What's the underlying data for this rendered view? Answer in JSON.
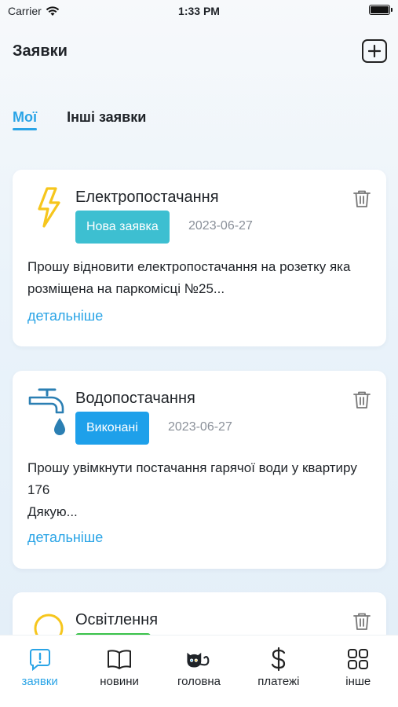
{
  "status_bar": {
    "carrier": "Carrier",
    "time": "1:33 PM"
  },
  "header": {
    "title": "Заявки",
    "add_icon": "plus-square-icon"
  },
  "tabs": [
    {
      "label": "Мої",
      "active": true
    },
    {
      "label": "Інші заявки",
      "active": false
    }
  ],
  "requests": [
    {
      "category": "Електропостачання",
      "icon": "lightning-icon",
      "status": "Нова заявка",
      "status_color": "#3dbfd1",
      "date": "2023-06-27",
      "description": "Прошу відновити електропостачання на розетку яка розміщена на паркомісці №25...",
      "more_label": "детальніше"
    },
    {
      "category": "Водопостачання",
      "icon": "water-tap-icon",
      "status": "Виконані",
      "status_color": "#1ea0ea",
      "date": "2023-06-27",
      "description": "Прошу увімкнути постачання гарячої води у квартиру 176\nДякую...",
      "more_label": "детальніше"
    },
    {
      "category": "Освітлення",
      "icon": "lightbulb-icon",
      "status_color": "#3ac24a"
    }
  ],
  "tabbar": [
    {
      "label": "заявки",
      "icon": "request-chat-icon",
      "active": true
    },
    {
      "label": "новини",
      "icon": "book-icon",
      "active": false
    },
    {
      "label": "головна",
      "icon": "cat-home-icon",
      "active": false
    },
    {
      "label": "платежі",
      "icon": "dollar-icon",
      "active": false
    },
    {
      "label": "інше",
      "icon": "grid-icon",
      "active": false
    }
  ],
  "colors": {
    "accent": "#2aa4e6",
    "lightning": "#f6c61d",
    "tap": "#2b7fb3"
  }
}
